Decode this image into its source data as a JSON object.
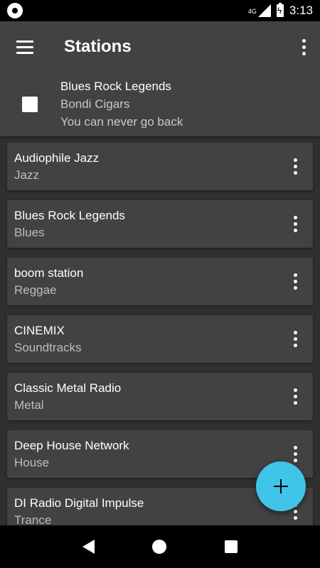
{
  "status_bar": {
    "network": "4G",
    "time": "3:13",
    "app_icon": "notification-dot-icon",
    "battery_icon": "battery-charging-icon",
    "signal_icon": "signal-icon"
  },
  "app_bar": {
    "title": "Stations",
    "menu_icon": "hamburger-menu-icon",
    "overflow_icon": "more-vert-icon"
  },
  "now_playing": {
    "station": "Blues Rock Legends",
    "artist": "Bondi Cigars",
    "track": "You can never go back",
    "control_icon": "stop-icon"
  },
  "stations": [
    {
      "name": "Audiophile Jazz",
      "genre": "Jazz"
    },
    {
      "name": "Blues Rock Legends",
      "genre": "Blues"
    },
    {
      "name": "boom station",
      "genre": "Reggae"
    },
    {
      "name": "CINEMIX",
      "genre": "Soundtracks"
    },
    {
      "name": "Classic Metal Radio",
      "genre": "Metal"
    },
    {
      "name": "Deep House Network",
      "genre": "House"
    },
    {
      "name": "DI Radio Digital Impulse",
      "genre": "Trance"
    }
  ],
  "fab": {
    "icon": "add-icon",
    "color": "#40c4e8"
  },
  "nav_bar": {
    "back_icon": "back-icon",
    "home_icon": "home-icon",
    "recents_icon": "recents-icon"
  },
  "colors": {
    "app_bar": "#424242",
    "background": "#303030",
    "card": "#424242"
  }
}
